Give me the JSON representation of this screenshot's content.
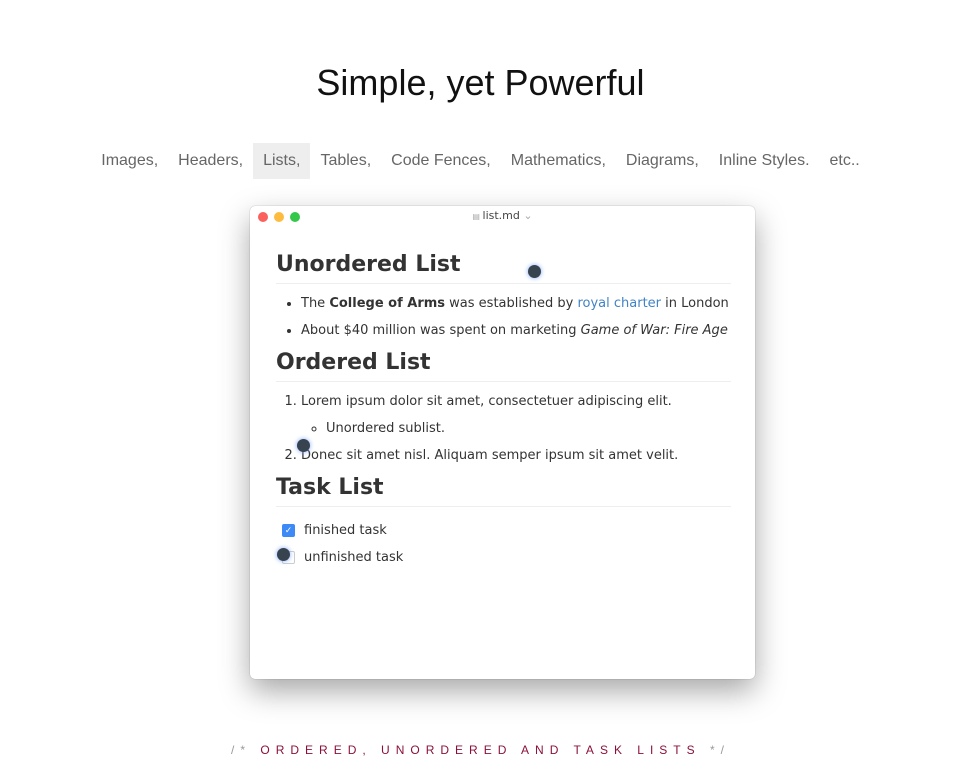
{
  "title": "Simple, yet Powerful",
  "features": [
    "Images,",
    "Headers,",
    "Lists,",
    "Tables,",
    "Code Fences,",
    "Mathematics,",
    "Diagrams,",
    "Inline Styles.",
    "etc.."
  ],
  "active_feature": "Lists,",
  "window": {
    "filename": "list.md",
    "unordered": {
      "heading": "Unordered List",
      "item1": {
        "pre": "The ",
        "bold": "College of Arms",
        "mid": " was established by ",
        "link": "royal charter",
        "post": " in London"
      },
      "item2": {
        "pre": "About $40 million was spent on marketing ",
        "italic": "Game of War: Fire Age"
      }
    },
    "ordered": {
      "heading": "Ordered List",
      "item1": "Lorem ipsum dolor sit amet, consectetuer adipiscing elit.",
      "sub1": "Unordered sublist.",
      "item2": "Donec sit amet nisl. Aliquam semper ipsum sit amet velit."
    },
    "tasks": {
      "heading": "Task List",
      "items": [
        {
          "label": "finished task",
          "checked": true
        },
        {
          "label": "unfinished task",
          "checked": false
        }
      ]
    }
  },
  "caption": {
    "open": "/* ",
    "text": "ORDERED, UNORDERED AND TASK LISTS",
    "close": " */"
  },
  "colors": {
    "close": "#fc605c",
    "minimize": "#fdbc40",
    "zoom": "#34c84a",
    "link": "#4183c4",
    "checkbox": "#3d8af7"
  }
}
